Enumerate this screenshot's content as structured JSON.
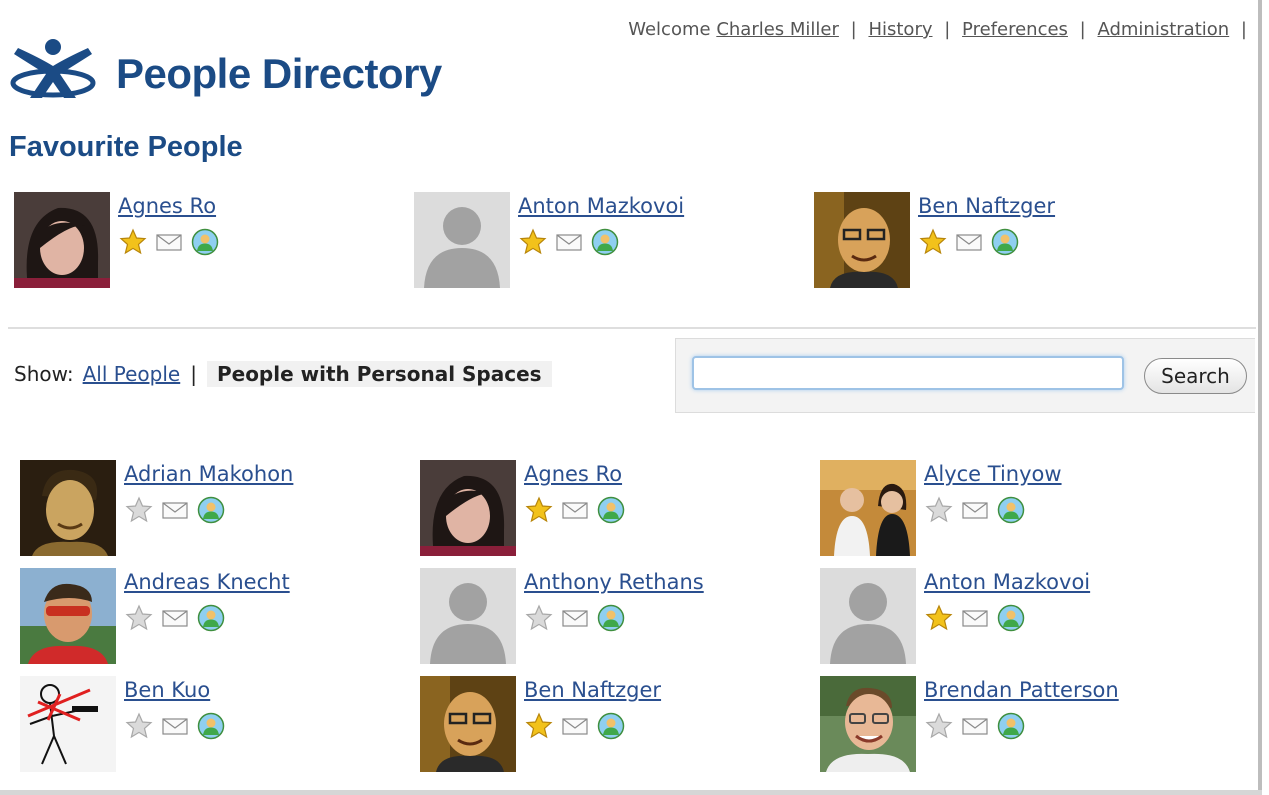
{
  "header": {
    "welcome_prefix": "Welcome",
    "user_name": "Charles Miller",
    "separator": "|",
    "links": [
      "History",
      "Preferences",
      "Administration"
    ],
    "app_title": "People Directory",
    "logo_icon": "people-directory-logo-icon"
  },
  "favourites": {
    "title": "Favourite People",
    "people": [
      {
        "name": "Agnes Ro",
        "favourite": true,
        "photo": "woman-dark-hair"
      },
      {
        "name": "Anton Mazkovoi",
        "favourite": true,
        "photo": "default-avatar"
      },
      {
        "name": "Ben Naftzger",
        "favourite": true,
        "photo": "man-glasses-dark"
      }
    ]
  },
  "filter": {
    "show_label": "Show:",
    "all_people": "All People",
    "separator": "|",
    "personal_spaces": "People with Personal Spaces"
  },
  "search": {
    "value": "",
    "placeholder": "",
    "button_label": "Search"
  },
  "people": [
    {
      "name": "Adrian Makohon",
      "favourite": false,
      "photo": "man-sepia"
    },
    {
      "name": "Agnes Ro",
      "favourite": true,
      "photo": "woman-dark-hair"
    },
    {
      "name": "Alyce Tinyow",
      "favourite": false,
      "photo": "couple"
    },
    {
      "name": "Andreas Knecht",
      "favourite": false,
      "photo": "man-sunglasses"
    },
    {
      "name": "Anthony Rethans",
      "favourite": false,
      "photo": "default-avatar"
    },
    {
      "name": "Anton Mazkovoi",
      "favourite": true,
      "photo": "default-avatar"
    },
    {
      "name": "Ben Kuo",
      "favourite": false,
      "photo": "stick-figure-drawing"
    },
    {
      "name": "Ben Naftzger",
      "favourite": true,
      "photo": "man-glasses-dark"
    },
    {
      "name": "Brendan Patterson",
      "favourite": false,
      "photo": "man-glasses-smiling"
    }
  ],
  "icons": {
    "favourite": "star-icon",
    "email": "envelope-icon",
    "profile": "profile-icon"
  },
  "colors": {
    "heading": "#1b4b85",
    "link": "#2a4f8f",
    "star_on": "#f2c21b",
    "star_off": "#dadada"
  }
}
